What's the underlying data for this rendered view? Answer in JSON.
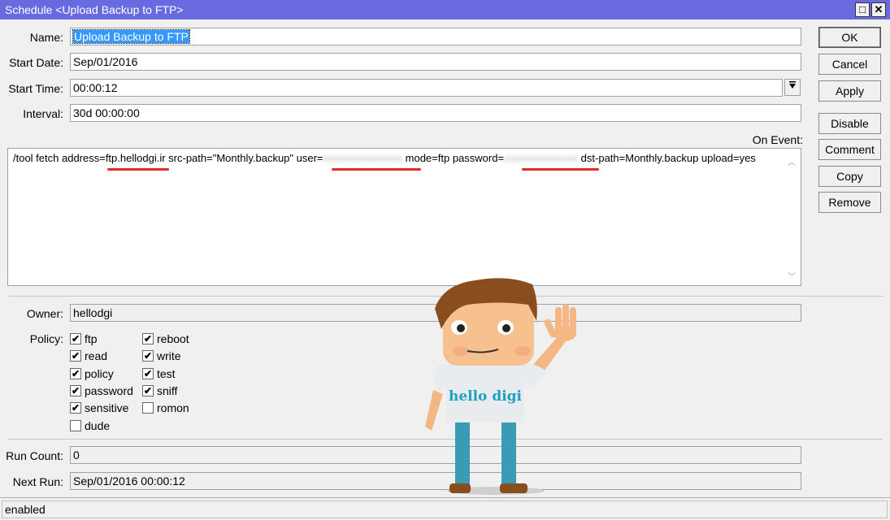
{
  "window": {
    "title": "Schedule <Upload Backup to FTP>",
    "maximize_glyph": "□",
    "close_glyph": "✕"
  },
  "form": {
    "name_label": "Name:",
    "name_value": "Upload Backup to FTP",
    "start_date_label": "Start Date:",
    "start_date_value": "Sep/01/2016",
    "start_time_label": "Start Time:",
    "start_time_value": "00:00:12",
    "interval_label": "Interval:",
    "interval_value": "30d 00:00:00",
    "on_event_label": "On Event:",
    "on_event_parts": {
      "p1": "/tool fetch address=ftp.",
      "host": "hellodgi.ir",
      "p2": " src-path=\"Monthly.backup\" user=",
      "user_blur": "xxxxxxxxxxxxxxx",
      "p3": " mode=ftp password=",
      "pass_blur": "xxxxxxxxxxxxxx",
      "p4": " dst-path=Monthly.backup upload=yes"
    },
    "owner_label": "Owner:",
    "owner_value": "hellodgi",
    "policy_label": "Policy:",
    "policies": [
      {
        "label": "ftp",
        "checked": true
      },
      {
        "label": "reboot",
        "checked": true
      },
      {
        "label": "read",
        "checked": true
      },
      {
        "label": "write",
        "checked": true
      },
      {
        "label": "policy",
        "checked": true
      },
      {
        "label": "test",
        "checked": true
      },
      {
        "label": "password",
        "checked": true
      },
      {
        "label": "sniff",
        "checked": true
      },
      {
        "label": "sensitive",
        "checked": true
      },
      {
        "label": "romon",
        "checked": false
      },
      {
        "label": "dude",
        "checked": false
      }
    ],
    "run_count_label": "Run Count:",
    "run_count_value": "0",
    "next_run_label": "Next Run:",
    "next_run_value": "Sep/01/2016 00:00:12"
  },
  "buttons": {
    "ok": "OK",
    "cancel": "Cancel",
    "apply": "Apply",
    "disable": "Disable",
    "comment": "Comment",
    "copy": "Copy",
    "remove": "Remove"
  },
  "status": {
    "text": "enabled"
  },
  "mascot": {
    "shirt_text": "hello digi"
  },
  "colors": {
    "titlebar": "#6a6ae0",
    "selection": "#3399ff",
    "underline": "#e0282e",
    "mascot_shirt_text": "#1e9fc4"
  }
}
